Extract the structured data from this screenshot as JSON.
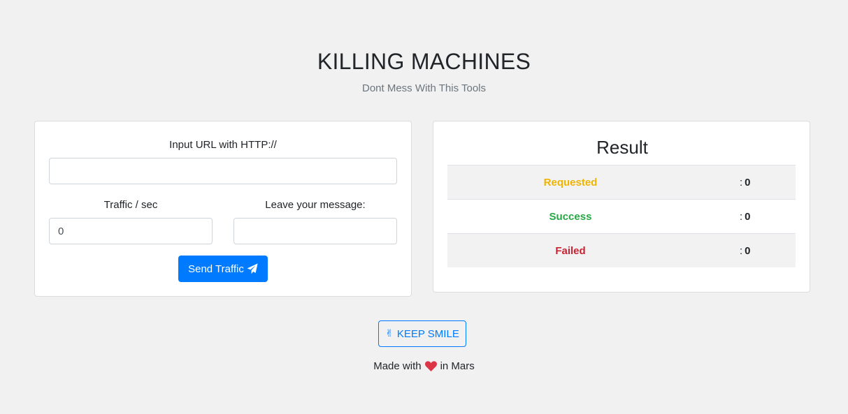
{
  "header": {
    "title": "KILLING MACHINES",
    "subtitle": "Dont Mess With This Tools"
  },
  "form": {
    "url_label": "Input URL with HTTP://",
    "url_value": "",
    "traffic_label": "Traffic / sec",
    "traffic_value": "0",
    "message_label": "Leave your message:",
    "message_value": "",
    "send_button_label": "Send Traffic",
    "send_icon": "paper-plane-icon"
  },
  "result": {
    "title": "Result",
    "rows": [
      {
        "label": "Requested",
        "colon": ":",
        "value": "0",
        "color": "#f0b400"
      },
      {
        "label": "Success",
        "colon": ":",
        "value": "0",
        "color": "#28a745"
      },
      {
        "label": "Failed",
        "colon": ":",
        "value": "0",
        "color": "#c82333"
      }
    ]
  },
  "smile_button": {
    "label": "KEEP SMILE",
    "icon": "victory-hand-icon"
  },
  "footer": {
    "prefix": "Made with",
    "suffix": "in Mars",
    "icon": "heart-icon"
  },
  "colors": {
    "primary": "#007bff",
    "background": "#f1f1f1",
    "heart": "#dc3545"
  }
}
